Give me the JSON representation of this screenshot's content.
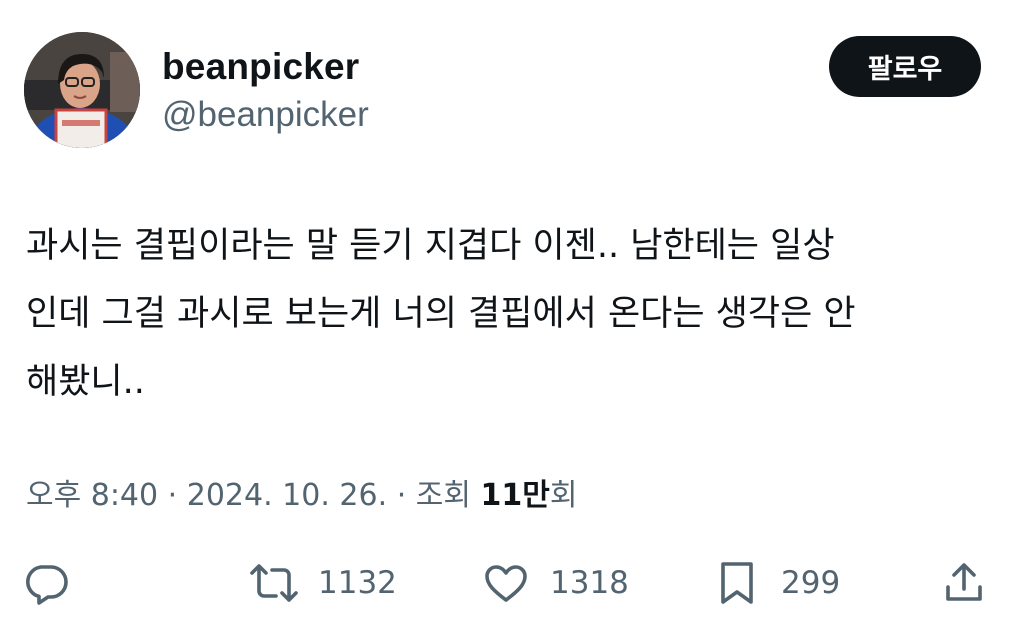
{
  "author": {
    "display_name": "beanpicker",
    "handle": "@beanpicker",
    "avatar_icon": "profile-photo"
  },
  "follow_button": {
    "label": "팔로우"
  },
  "tweet": {
    "text": "과시는 결핍이라는 말 듣기 지겹다 이젠.. 남한테는 일상\n인데 그걸 과시로 보는게 너의 결핍에서 온다는 생각은 안\n해봤니..",
    "time": "오후 8:40",
    "separator": "·",
    "date": "2024. 10. 26.",
    "views_label": "조회",
    "views_count": "11만",
    "views_suffix": "회"
  },
  "actions": {
    "reply": {
      "icon": "reply-icon"
    },
    "retweet": {
      "icon": "retweet-icon",
      "count": "1132"
    },
    "like": {
      "icon": "heart-icon",
      "count": "1318"
    },
    "bookmark": {
      "icon": "bookmark-icon",
      "count": "299"
    },
    "share": {
      "icon": "share-icon"
    }
  },
  "colors": {
    "text_primary": "#0f1419",
    "text_secondary": "#536471",
    "button_bg": "#0f1419",
    "background": "#ffffff"
  }
}
